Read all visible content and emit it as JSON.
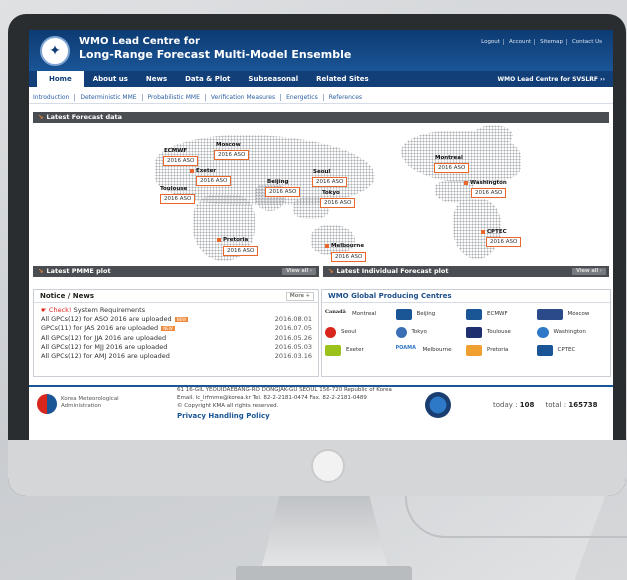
{
  "header": {
    "title_line1": "WMO Lead Centre for",
    "title_line2": "Long-Range Forecast Multi-Model Ensemble",
    "top_links": [
      "Logout",
      "Account",
      "Sitemap",
      "Contact Us"
    ]
  },
  "nav": {
    "items": [
      "Home",
      "About us",
      "News",
      "Data & Plot",
      "Subseasonal",
      "Related Sites"
    ],
    "right_label": "WMO Lead Centre for SVSLRF ››"
  },
  "subnav": [
    "Introduction",
    "Deterministic MME",
    "Probabilistic MME",
    "Verification Measures",
    "Energetics",
    "References"
  ],
  "forecast_section": {
    "title": "Latest Forecast data",
    "cities": [
      {
        "name": "ECMWF",
        "tag": "2016 ASO"
      },
      {
        "name": "Moscow",
        "tag": "2016 ASO"
      },
      {
        "name": "Exeter",
        "tag": "2016 ASO"
      },
      {
        "name": "Toulouse",
        "tag": "2016 ASO"
      },
      {
        "name": "Beijing",
        "tag": "2016 ASO"
      },
      {
        "name": "Seoul",
        "tag": "2016 ASO"
      },
      {
        "name": "Tokyo",
        "tag": "2016 ASO"
      },
      {
        "name": "Montreal",
        "tag": "2016 ASO"
      },
      {
        "name": "Washington",
        "tag": "2016 ASO"
      },
      {
        "name": "Pretoria",
        "tag": "2016 ASO"
      },
      {
        "name": "Melbourne",
        "tag": "2016 ASO"
      },
      {
        "name": "CPTEC",
        "tag": "2016 ASO"
      }
    ]
  },
  "plot_bars": {
    "pmme": "Latest PMME plot",
    "individual": "Latest Individual Forecast plot",
    "view_all": "View all"
  },
  "notice": {
    "title": "Notice / News",
    "more": "More",
    "check_label": "Check!",
    "check_text": "System Requirements",
    "new_badge": "NEW",
    "rows": [
      {
        "text": "All GPCs(12) for ASO 2016 are uploaded",
        "date": "2016.08.01"
      },
      {
        "text": "GPCs(11) for JAS 2016 are uploaded",
        "date": "2016.07.05"
      },
      {
        "text": "All GPCs(12) for JJA 2016 are uploaded",
        "date": "2016.05.26"
      },
      {
        "text": "All GPCs(12) for MJJ 2016 are uploaded",
        "date": "2016.05.03"
      },
      {
        "text": "All GPCs(12) for AMJ 2016 are uploaded",
        "date": "2016.03.16"
      }
    ]
  },
  "gpc": {
    "title": "WMO Global Producing Centres",
    "centres": [
      {
        "name": "Montreal",
        "color": "#d9261c"
      },
      {
        "name": "Beijing",
        "color": "#1a5596"
      },
      {
        "name": "ECMWF",
        "color": "#1a5596"
      },
      {
        "name": "Moscow",
        "color": "#2a4a8a"
      },
      {
        "name": "Seoul",
        "color": "#d9261c"
      },
      {
        "name": "Tokyo",
        "color": "#3a6fb5"
      },
      {
        "name": "Toulouse",
        "color": "#1d2f6f"
      },
      {
        "name": "Washington",
        "color": "#2e79c7"
      },
      {
        "name": "Exeter",
        "color": "#9bc21a"
      },
      {
        "name": "Melbourne",
        "color": "#2e79c7"
      },
      {
        "name": "Pretoria",
        "color": "#f0a030"
      },
      {
        "name": "CPTEC",
        "color": "#1a5596"
      }
    ],
    "logo_words": {
      "montreal": "Canadä",
      "melbourne": "POAMA"
    }
  },
  "footer": {
    "org_line1": "Korea Meteorological",
    "org_line2": "Administration",
    "address": "61 16-GIL YEOUIDAEBANG-RO DONGJAK-GU SEOUL 156-720 Republic of Korea",
    "contact": "Email. lc_lrfmme@korea.kr Tel. 82-2-2181-0474 Fax. 82-2-2181-0489",
    "copyright": "© Copyright KMA all rights reserved.",
    "privacy": "Privacy Handling Policy",
    "today_label": "today :",
    "today_count": "108",
    "total_label": "total :",
    "total_count": "165738"
  }
}
